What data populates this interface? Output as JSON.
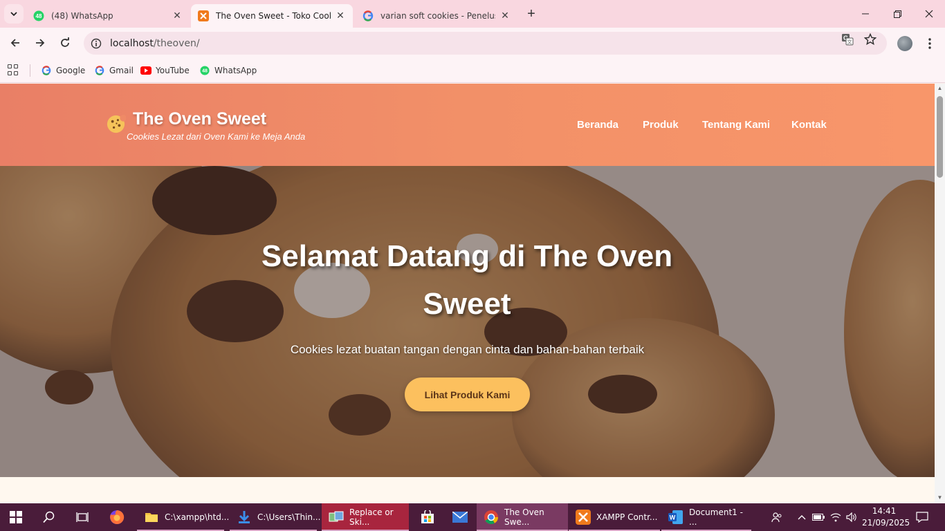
{
  "browser": {
    "tabs": [
      {
        "title": "(48) WhatsApp",
        "badge": "48",
        "active": false
      },
      {
        "title": "The Oven Sweet - Toko Cookies",
        "active": true
      },
      {
        "title": "varian soft cookies - Penelusuran Google",
        "active": false
      }
    ],
    "url_host": "localhost",
    "url_path": "/theoven/",
    "bookmarks": [
      {
        "label": "Google",
        "icon": "google-icon"
      },
      {
        "label": "Gmail",
        "icon": "google-icon"
      },
      {
        "label": "YouTube",
        "icon": "youtube-icon"
      },
      {
        "label": "WhatsApp",
        "icon": "whatsapp-icon",
        "badge": "48"
      }
    ]
  },
  "site": {
    "title": "The Oven Sweet",
    "tagline": "Cookies Lezat dari Oven Kami ke Meja Anda",
    "nav": [
      "Beranda",
      "Produk",
      "Tentang Kami",
      "Kontak"
    ],
    "hero": {
      "title": "Selamat Datang di The Oven Sweet",
      "subtitle": "Cookies lezat buatan tangan dengan cinta dan bahan-bahan terbaik",
      "cta": "Lihat Produk Kami"
    },
    "colors": {
      "header_start": "#e97f66",
      "header_end": "#f8966a",
      "cta": "#fcc05e"
    }
  },
  "taskbar": {
    "apps": [
      {
        "label": "C:\\xampp\\htd...",
        "icon": "folder-icon"
      },
      {
        "label": "C:\\Users\\Thin...",
        "icon": "download-icon"
      },
      {
        "label": "Replace or Ski...",
        "icon": "file-copy-icon"
      },
      {
        "label": "The Oven Swe...",
        "icon": "chrome-icon"
      },
      {
        "label": "XAMPP Contr...",
        "icon": "xampp-icon"
      },
      {
        "label": "Document1 - ...",
        "icon": "word-icon"
      }
    ],
    "time": "14:41",
    "date": "21/09/2025"
  }
}
